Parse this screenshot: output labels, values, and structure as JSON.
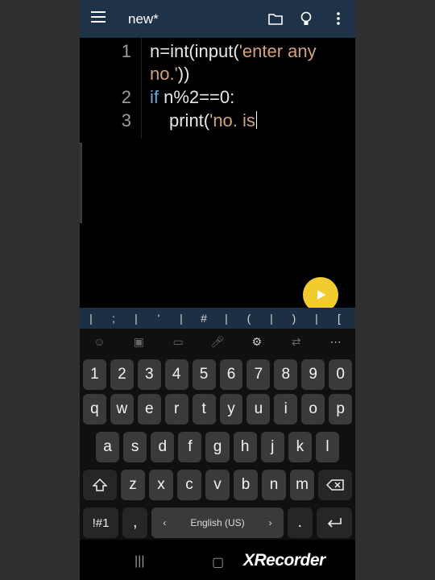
{
  "appbar": {
    "title": "new*"
  },
  "editor": {
    "line_numbers": [
      "1",
      "2",
      "3"
    ],
    "lines": {
      "l1_prefix": "n=int(input(",
      "l1_str": "'enter any",
      "l1b_str": "no.'",
      "l1b_suffix": "))",
      "l2_kw": "if",
      "l2_rest": " n%2==0:",
      "l3_prefix": "print(",
      "l3_str": "'no. is"
    }
  },
  "symbol_row": [
    "|",
    ";",
    "|",
    "'",
    "|",
    "#",
    "|",
    "(",
    "|",
    ")",
    "|",
    "["
  ],
  "keyboard": {
    "row_numbers": [
      "1",
      "2",
      "3",
      "4",
      "5",
      "6",
      "7",
      "8",
      "9",
      "0"
    ],
    "row_q": [
      "q",
      "w",
      "e",
      "r",
      "t",
      "y",
      "u",
      "i",
      "o",
      "p"
    ],
    "row_a": [
      "a",
      "s",
      "d",
      "f",
      "g",
      "h",
      "j",
      "k",
      "l"
    ],
    "row_z": [
      "z",
      "x",
      "c",
      "v",
      "b",
      "n",
      "m"
    ],
    "sym_key": "!#1",
    "comma_key": ",",
    "space_label": "English (US)",
    "period_key": "."
  },
  "watermark": "XRecorder"
}
